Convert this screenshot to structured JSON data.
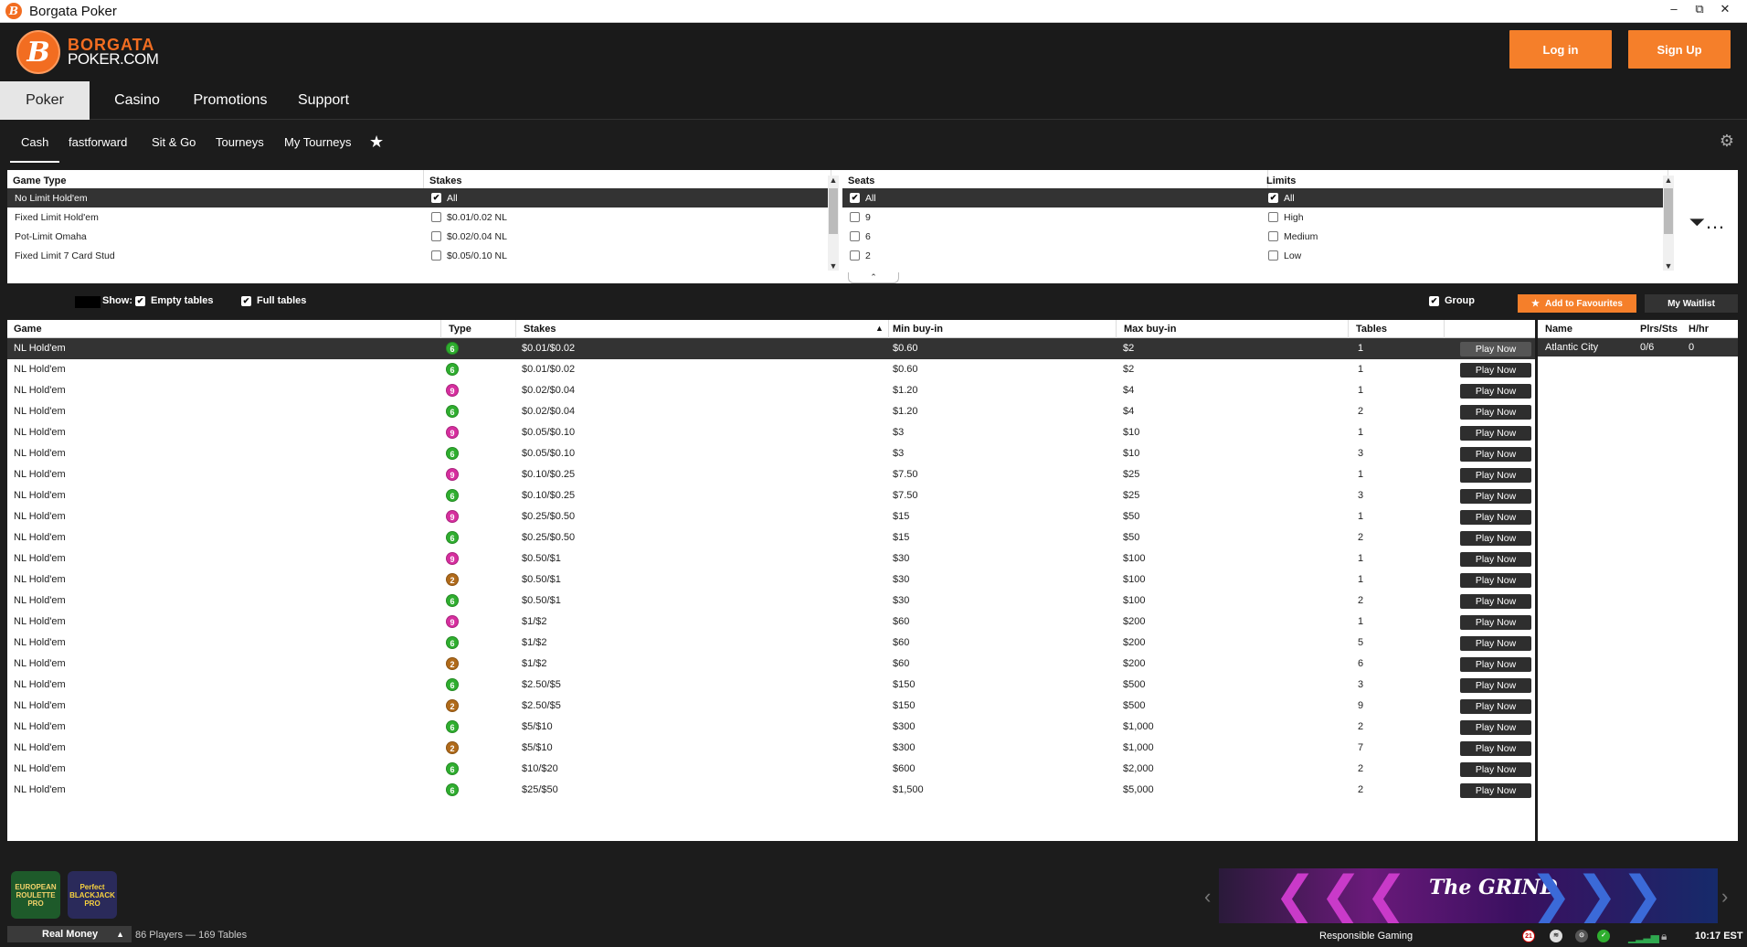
{
  "window": {
    "title": "Borgata Poker",
    "minimize": "–",
    "maximize": "⧉",
    "close": "✕"
  },
  "header": {
    "logo_line1": "BORGATA",
    "logo_line2": "POKER.COM",
    "login_label": "Log in",
    "signup_label": "Sign Up"
  },
  "main_tabs": [
    "Poker",
    "Casino",
    "Promotions",
    "Support"
  ],
  "sub_tabs": [
    "Cash",
    "fastforward",
    "Sit & Go",
    "Tourneys",
    "My Tourneys"
  ],
  "filters": {
    "game_type": {
      "header": "Game Type",
      "items": [
        "No Limit Hold'em",
        "Fixed Limit Hold'em",
        "Pot-Limit Omaha",
        "Fixed Limit 7 Card Stud"
      ]
    },
    "stakes": {
      "header": "Stakes",
      "items": [
        "All",
        "$0.01/0.02 NL",
        "$0.02/0.04 NL",
        "$0.05/0.10 NL"
      ]
    },
    "seats": {
      "header": "Seats",
      "items": [
        "All",
        "9",
        "6",
        "2"
      ]
    },
    "limits": {
      "header": "Limits",
      "items": [
        "All",
        "High",
        "Medium",
        "Low"
      ]
    }
  },
  "showbar": {
    "show_label": "Show:",
    "empty_tables": "Empty tables",
    "full_tables": "Full tables",
    "group": "Group",
    "add_favourites": "Add to Favourites",
    "my_waitlist": "My Waitlist"
  },
  "table": {
    "headers": {
      "game": "Game",
      "type": "Type",
      "stakes": "Stakes",
      "min_buyin": "Min buy-in",
      "max_buyin": "Max buy-in",
      "tables": "Tables"
    },
    "play_label": "Play Now",
    "rows": [
      {
        "game": "NL Hold'em",
        "type": "6",
        "stakes": "$0.01/$0.02",
        "min": "$0.60",
        "max": "$2",
        "tables": "1"
      },
      {
        "game": "NL Hold'em",
        "type": "6",
        "stakes": "$0.01/$0.02",
        "min": "$0.60",
        "max": "$2",
        "tables": "1"
      },
      {
        "game": "NL Hold'em",
        "type": "9",
        "stakes": "$0.02/$0.04",
        "min": "$1.20",
        "max": "$4",
        "tables": "1"
      },
      {
        "game": "NL Hold'em",
        "type": "6",
        "stakes": "$0.02/$0.04",
        "min": "$1.20",
        "max": "$4",
        "tables": "2"
      },
      {
        "game": "NL Hold'em",
        "type": "9",
        "stakes": "$0.05/$0.10",
        "min": "$3",
        "max": "$10",
        "tables": "1"
      },
      {
        "game": "NL Hold'em",
        "type": "6",
        "stakes": "$0.05/$0.10",
        "min": "$3",
        "max": "$10",
        "tables": "3"
      },
      {
        "game": "NL Hold'em",
        "type": "9",
        "stakes": "$0.10/$0.25",
        "min": "$7.50",
        "max": "$25",
        "tables": "1"
      },
      {
        "game": "NL Hold'em",
        "type": "6",
        "stakes": "$0.10/$0.25",
        "min": "$7.50",
        "max": "$25",
        "tables": "3"
      },
      {
        "game": "NL Hold'em",
        "type": "9",
        "stakes": "$0.25/$0.50",
        "min": "$15",
        "max": "$50",
        "tables": "1"
      },
      {
        "game": "NL Hold'em",
        "type": "6",
        "stakes": "$0.25/$0.50",
        "min": "$15",
        "max": "$50",
        "tables": "2"
      },
      {
        "game": "NL Hold'em",
        "type": "9",
        "stakes": "$0.50/$1",
        "min": "$30",
        "max": "$100",
        "tables": "1"
      },
      {
        "game": "NL Hold'em",
        "type": "2",
        "stakes": "$0.50/$1",
        "min": "$30",
        "max": "$100",
        "tables": "1"
      },
      {
        "game": "NL Hold'em",
        "type": "6",
        "stakes": "$0.50/$1",
        "min": "$30",
        "max": "$100",
        "tables": "2"
      },
      {
        "game": "NL Hold'em",
        "type": "9",
        "stakes": "$1/$2",
        "min": "$60",
        "max": "$200",
        "tables": "1"
      },
      {
        "game": "NL Hold'em",
        "type": "6",
        "stakes": "$1/$2",
        "min": "$60",
        "max": "$200",
        "tables": "5"
      },
      {
        "game": "NL Hold'em",
        "type": "2",
        "stakes": "$1/$2",
        "min": "$60",
        "max": "$200",
        "tables": "6"
      },
      {
        "game": "NL Hold'em",
        "type": "6",
        "stakes": "$2.50/$5",
        "min": "$150",
        "max": "$500",
        "tables": "3"
      },
      {
        "game": "NL Hold'em",
        "type": "2",
        "stakes": "$2.50/$5",
        "min": "$150",
        "max": "$500",
        "tables": "9"
      },
      {
        "game": "NL Hold'em",
        "type": "6",
        "stakes": "$5/$10",
        "min": "$300",
        "max": "$1,000",
        "tables": "2"
      },
      {
        "game": "NL Hold'em",
        "type": "2",
        "stakes": "$5/$10",
        "min": "$300",
        "max": "$1,000",
        "tables": "7"
      },
      {
        "game": "NL Hold'em",
        "type": "6",
        "stakes": "$10/$20",
        "min": "$600",
        "max": "$2,000",
        "tables": "2"
      },
      {
        "game": "NL Hold'em",
        "type": "6",
        "stakes": "$25/$50",
        "min": "$1,500",
        "max": "$5,000",
        "tables": "2"
      }
    ]
  },
  "badge_colors": {
    "6": "#2fae2f",
    "9": "#d62e9e",
    "2": "#b06a1a"
  },
  "side": {
    "headers": {
      "name": "Name",
      "plrs": "Plrs/Sts",
      "hhr": "H/hr"
    },
    "row": {
      "name": "Atlantic City",
      "plrs": "0/6",
      "hhr": "0"
    }
  },
  "bottom": {
    "tile1": "EUROPEAN ROULETTE PRO",
    "tile2": "Perfect BLACKJACK PRO",
    "money_mode": "Real Money",
    "players": "86 Players",
    "dash": "—",
    "tables": "169 Tables",
    "banner_text": "The GRIND",
    "responsible": "Responsible Gaming",
    "time": "10:17 EST"
  }
}
